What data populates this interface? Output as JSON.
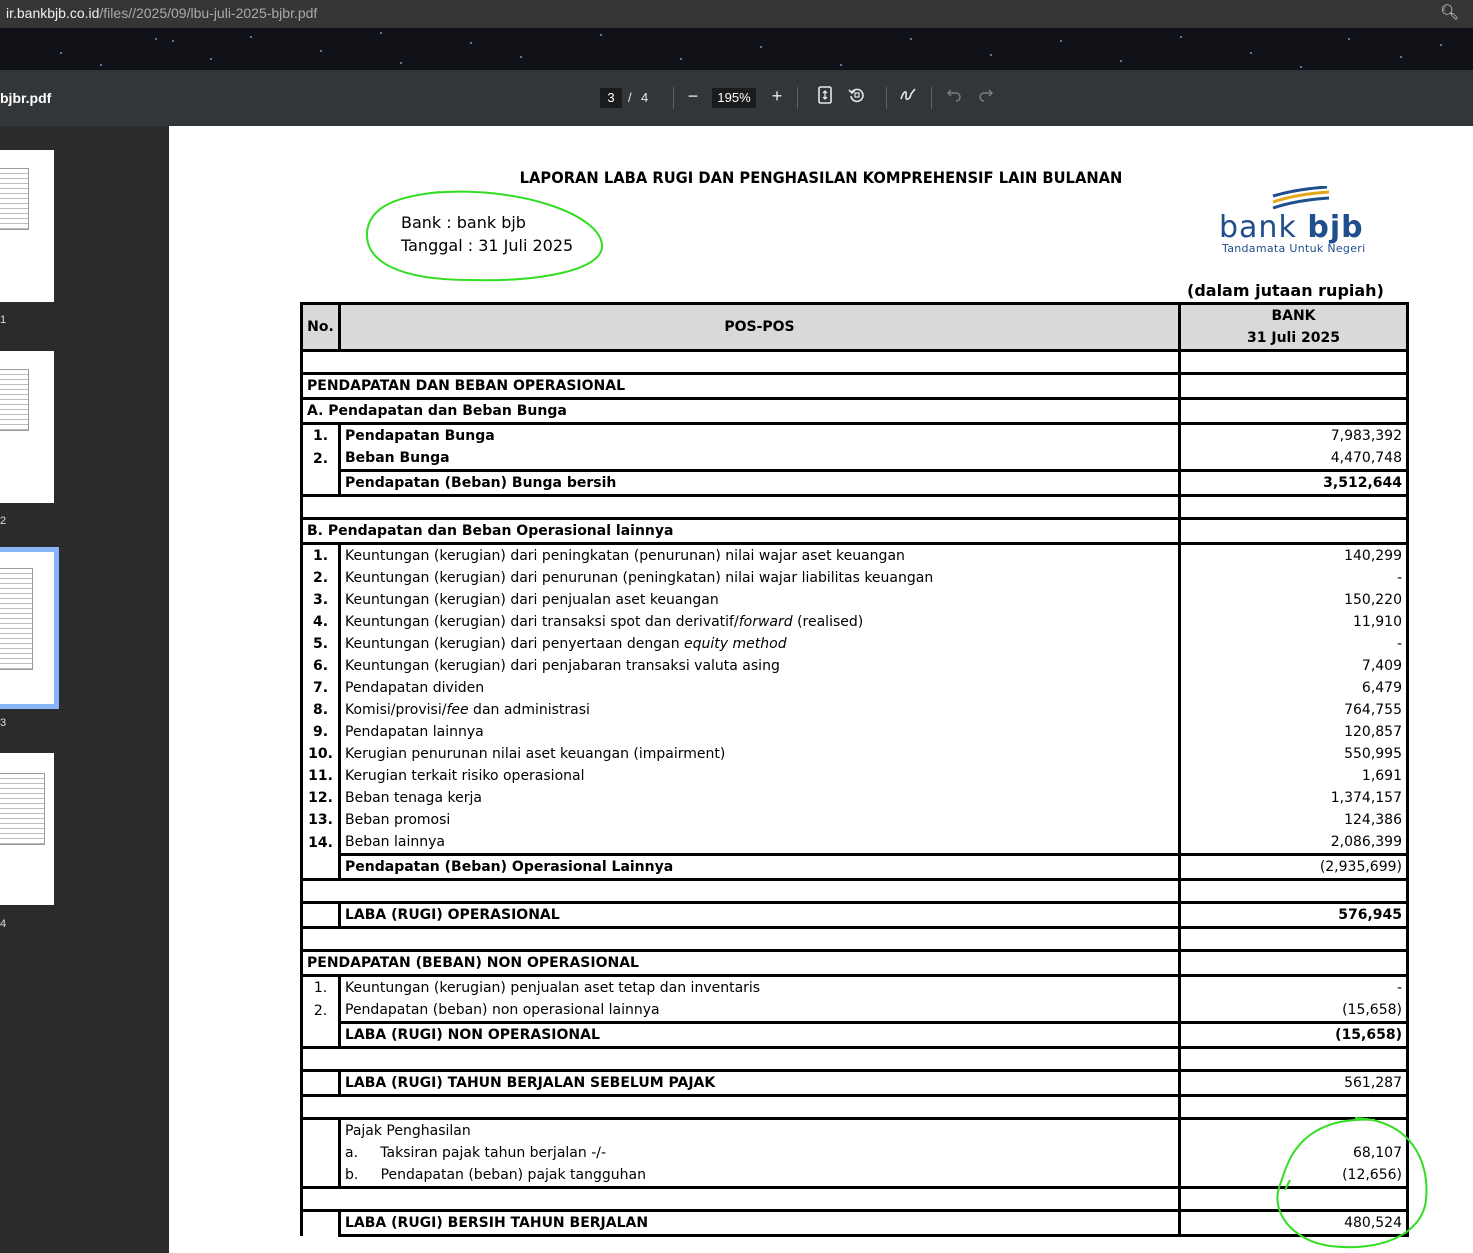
{
  "browser": {
    "url_host": "ir.bankbjb.co.id",
    "url_path": "/files//2025/09/lbu-juli-2025-bjbr.pdf"
  },
  "toolbar": {
    "file_name": "bjbr.pdf",
    "current_page": "3",
    "page_separator": "/",
    "total_pages": "4",
    "zoom": "195%",
    "zoom_out": "−",
    "zoom_in": "+"
  },
  "thumbnails": [
    {
      "label": "1"
    },
    {
      "label": "2"
    },
    {
      "label": "3"
    },
    {
      "label": "4"
    }
  ],
  "document": {
    "title": "LAPORAN LABA RUGI DAN PENGHASILAN KOMPREHENSIF LAIN BULANAN",
    "bank_line": "Bank : bank bjb",
    "date_line": "Tanggal : 31 Juli 2025",
    "logo_word_light": "bank ",
    "logo_word_bold": "bjb",
    "logo_tagline": "Tandamata Untuk Negeri",
    "unit": "(dalam jutaan rupiah)",
    "header": {
      "no": "No.",
      "pos": "POS-POS",
      "col_line1": "BANK",
      "col_line2": "31 Juli 2025"
    },
    "rows": [
      {
        "type": "blank"
      },
      {
        "type": "section",
        "label": "PENDAPATAN DAN BEBAN OPERASIONAL"
      },
      {
        "type": "section",
        "label": "A. Pendapatan dan Beban Bunga"
      },
      {
        "type": "item",
        "no": "1.",
        "label": "Pendapatan Bunga",
        "value": "7,983,392",
        "bold_label": true
      },
      {
        "type": "item",
        "no": "2.",
        "label": "Beban Bunga",
        "value": "4,470,748",
        "bold_label": true
      },
      {
        "type": "total",
        "label": "Pendapatan (Beban) Bunga bersih",
        "value": "3,512,644",
        "bold_value": true
      },
      {
        "type": "blank"
      },
      {
        "type": "section",
        "label": "B. Pendapatan dan Beban Operasional lainnya"
      },
      {
        "type": "item",
        "no": "1.",
        "label": "Keuntungan (kerugian) dari peningkatan (penurunan) nilai wajar aset keuangan",
        "value": "140,299"
      },
      {
        "type": "item",
        "no": "2.",
        "label": "Keuntungan (kerugian) dari penurunan (peningkatan) nilai wajar liabilitas keuangan",
        "value": "-"
      },
      {
        "type": "item",
        "no": "3.",
        "label": "Keuntungan (kerugian) dari penjualan aset keuangan",
        "value": "150,220"
      },
      {
        "type": "item",
        "no": "4.",
        "label": "Keuntungan (kerugian) dari transaksi spot dan derivatif/",
        "italic": "forward",
        "label_after": " (realised)",
        "value": "11,910"
      },
      {
        "type": "item",
        "no": "5.",
        "label": "Keuntungan (kerugian) dari penyertaan dengan ",
        "italic": "equity method",
        "label_after": "",
        "value": "-"
      },
      {
        "type": "item",
        "no": "6.",
        "label": "Keuntungan (kerugian) dari penjabaran transaksi valuta asing",
        "value": "7,409"
      },
      {
        "type": "item",
        "no": "7.",
        "label": "Pendapatan dividen",
        "value": "6,479"
      },
      {
        "type": "item",
        "no": "8.",
        "label": "Komisi/provisi/",
        "italic": "fee",
        "label_after": " dan administrasi",
        "value": "764,755"
      },
      {
        "type": "item",
        "no": "9.",
        "label": "Pendapatan lainnya",
        "value": "120,857"
      },
      {
        "type": "item",
        "no": "10.",
        "label": "Kerugian penurunan nilai aset keuangan (impairment)",
        "value": "550,995"
      },
      {
        "type": "item",
        "no": "11.",
        "label": "Kerugian terkait risiko operasional",
        "value": "1,691"
      },
      {
        "type": "item",
        "no": "12.",
        "label": "Beban tenaga kerja",
        "value": "1,374,157"
      },
      {
        "type": "item",
        "no": "13.",
        "label": "Beban promosi",
        "value": "124,386"
      },
      {
        "type": "item",
        "no": "14.",
        "label": "Beban lainnya",
        "value": "2,086,399"
      },
      {
        "type": "total",
        "label": "Pendapatan (Beban) Operasional Lainnya",
        "value": "(2,935,699)",
        "bold_value": false
      },
      {
        "type": "blank"
      },
      {
        "type": "total",
        "label": "LABA (RUGI) OPERASIONAL",
        "value": "576,945",
        "bold_value": true
      },
      {
        "type": "blank"
      },
      {
        "type": "section",
        "label": "PENDAPATAN (BEBAN) NON OPERASIONAL"
      },
      {
        "type": "item",
        "no": "1.",
        "label": "Keuntungan (kerugian) penjualan aset tetap dan inventaris",
        "value": "-",
        "plain_no": true
      },
      {
        "type": "item",
        "no": "2.",
        "label": "Pendapatan (beban) non operasional lainnya",
        "value": "(15,658)",
        "plain_no": true
      },
      {
        "type": "total",
        "label": "LABA (RUGI) NON OPERASIONAL",
        "value": "(15,658)",
        "bold_value": true
      },
      {
        "type": "blank"
      },
      {
        "type": "total",
        "label": "LABA (RUGI) TAHUN BERJALAN SEBELUM PAJAK",
        "value": "561,287",
        "bold_value": false
      },
      {
        "type": "blank"
      },
      {
        "type": "plain",
        "label": "Pajak Penghasilan",
        "value": ""
      },
      {
        "type": "plain",
        "label": "a.     Taksiran pajak tahun berjalan -/-",
        "value": "68,107"
      },
      {
        "type": "plain",
        "label": "b.     Pendapatan (beban) pajak tangguhan",
        "value": "(12,656)"
      },
      {
        "type": "blank"
      },
      {
        "type": "total",
        "label": "LABA (RUGI) BERSIH TAHUN BERJALAN",
        "value": "480,524",
        "bold_value": false
      }
    ]
  },
  "colors": {
    "annotation": "#33dd22",
    "thumb_highlight": "#8ab4f8",
    "logo_blue": "#1f4e8c",
    "logo_gold": "#e6a817"
  }
}
